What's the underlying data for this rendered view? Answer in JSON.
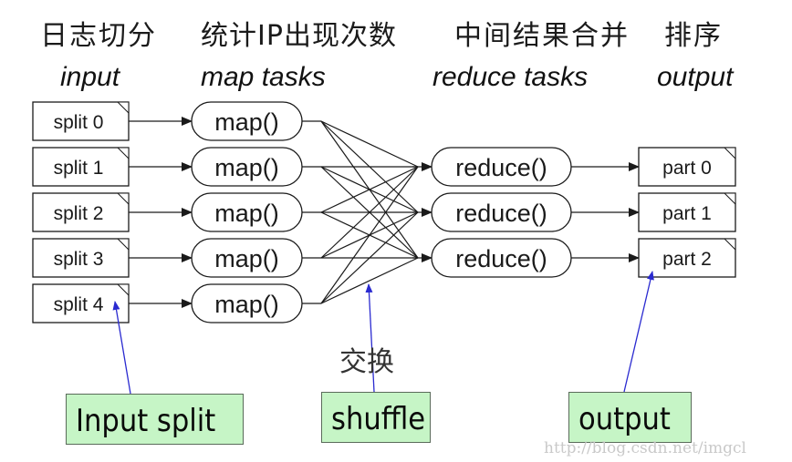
{
  "stage_titles_cn": [
    {
      "id": "split",
      "text": "日志切分"
    },
    {
      "id": "map",
      "text": "统计IP出现次数"
    },
    {
      "id": "reduce",
      "text": "中间结果合并"
    },
    {
      "id": "sort",
      "text": "排序"
    }
  ],
  "column_headers": {
    "input": "input",
    "map": "map tasks",
    "reduce": "reduce tasks",
    "output": "output"
  },
  "inputs": [
    "split 0",
    "split 1",
    "split 2",
    "split 3",
    "split 4"
  ],
  "maps": [
    "map()",
    "map()",
    "map()",
    "map()",
    "map()"
  ],
  "reduces": [
    "reduce()",
    "reduce()",
    "reduce()"
  ],
  "outputs": [
    "part 0",
    "part 1",
    "part 2"
  ],
  "shuffle_label_cn": "交换",
  "callouts": {
    "input_split": "Input split",
    "shuffle": "shuffle",
    "output": "output"
  },
  "colors": {
    "callout_fill": "#c6f5c6",
    "pointer_line": "#2a2ad0",
    "stroke": "#1a1a1a"
  },
  "watermark": "http://blog.csdn.net/imgcl"
}
